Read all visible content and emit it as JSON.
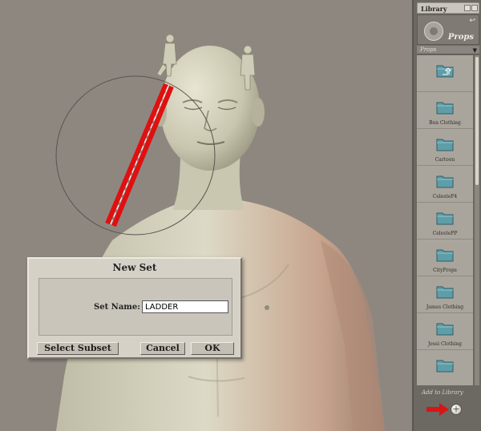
{
  "library": {
    "title": "Library",
    "category": "Props",
    "subcategory": "Props",
    "items": [
      {
        "label": "",
        "icon": "up-folder-icon"
      },
      {
        "label": "Ben Clothing",
        "icon": "folder-icon"
      },
      {
        "label": "Cartoon",
        "icon": "folder-icon"
      },
      {
        "label": "CelesteP4",
        "icon": "folder-icon"
      },
      {
        "label": "CelestePP",
        "icon": "folder-icon"
      },
      {
        "label": "CityProps",
        "icon": "folder-icon"
      },
      {
        "label": "James Clothing",
        "icon": "folder-icon"
      },
      {
        "label": "Jessi Clothing",
        "icon": "folder-icon"
      },
      {
        "label": "",
        "icon": "folder-icon"
      }
    ],
    "add_label": "Add to Library",
    "add_symbol": "+"
  },
  "dialog": {
    "title": "New Set",
    "set_name_label": "Set Name:",
    "set_name_value": "LADDER",
    "select_subset_label": "Select Subset",
    "cancel_label": "Cancel",
    "ok_label": "OK"
  },
  "colors": {
    "folder": "#5f9ea8",
    "ladder": "#e01010",
    "arrow": "#d81515",
    "skin": "#d2d0ba"
  }
}
